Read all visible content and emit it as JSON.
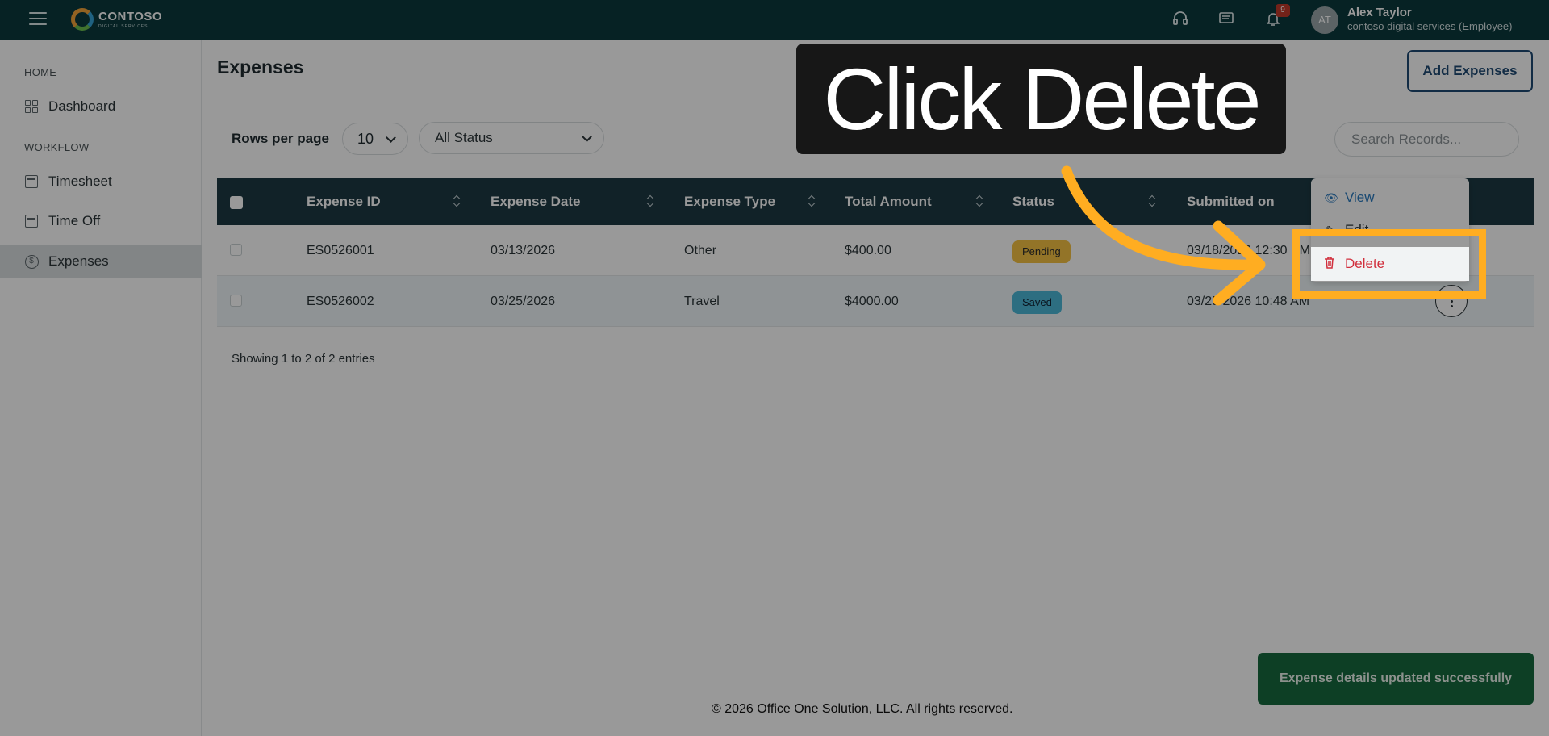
{
  "header": {
    "logo_text": "CONTOSO",
    "logo_subtext": "DIGITAL SERVICES",
    "notification_count": "9",
    "user_initials": "AT",
    "user_name": "Alex Taylor",
    "user_org": "contoso digital services (Employee)"
  },
  "sidebar": {
    "section_home": "HOME",
    "section_workflow": "WORKFLOW",
    "items": [
      {
        "label": "Dashboard"
      },
      {
        "label": "Timesheet"
      },
      {
        "label": "Time Off"
      },
      {
        "label": "Expenses"
      }
    ]
  },
  "page": {
    "title": "Expenses",
    "add_button": "Add Expenses"
  },
  "filters": {
    "rows_per_page_label": "Rows per page",
    "rows_per_page_value": "10",
    "status_value": "All Status",
    "search_placeholder": "Search Records..."
  },
  "table": {
    "columns": [
      "Expense ID",
      "Expense Date",
      "Expense Type",
      "Total Amount",
      "Status",
      "Submitted on"
    ],
    "rows": [
      {
        "id": "ES0526001",
        "date": "03/13/2026",
        "type": "Other",
        "amount": "$400.00",
        "status": "Pending",
        "submitted": "03/18/2026 12:30 PM"
      },
      {
        "id": "ES0526002",
        "date": "03/25/2026",
        "type": "Travel",
        "amount": "$4000.00",
        "status": "Saved",
        "submitted": "03/25/2026 10:48 AM"
      }
    ],
    "showing": "Showing 1 to 2 of 2 entries"
  },
  "row_menu": {
    "view": "View",
    "edit": "Edit",
    "delete": "Delete"
  },
  "overlay": {
    "instruction": "Click Delete",
    "highlight_color": "#ffad21"
  },
  "toast": "Expense details updated successfully",
  "footer": "© 2026 Office One Solution, LLC. All rights reserved.",
  "colors": {
    "topbar": "#0b3a3d",
    "table_header": "#1d3a44",
    "pending": "#f5c243",
    "saved": "#4cb8d8",
    "delete": "#d12f3d",
    "toast": "#166a3e"
  }
}
